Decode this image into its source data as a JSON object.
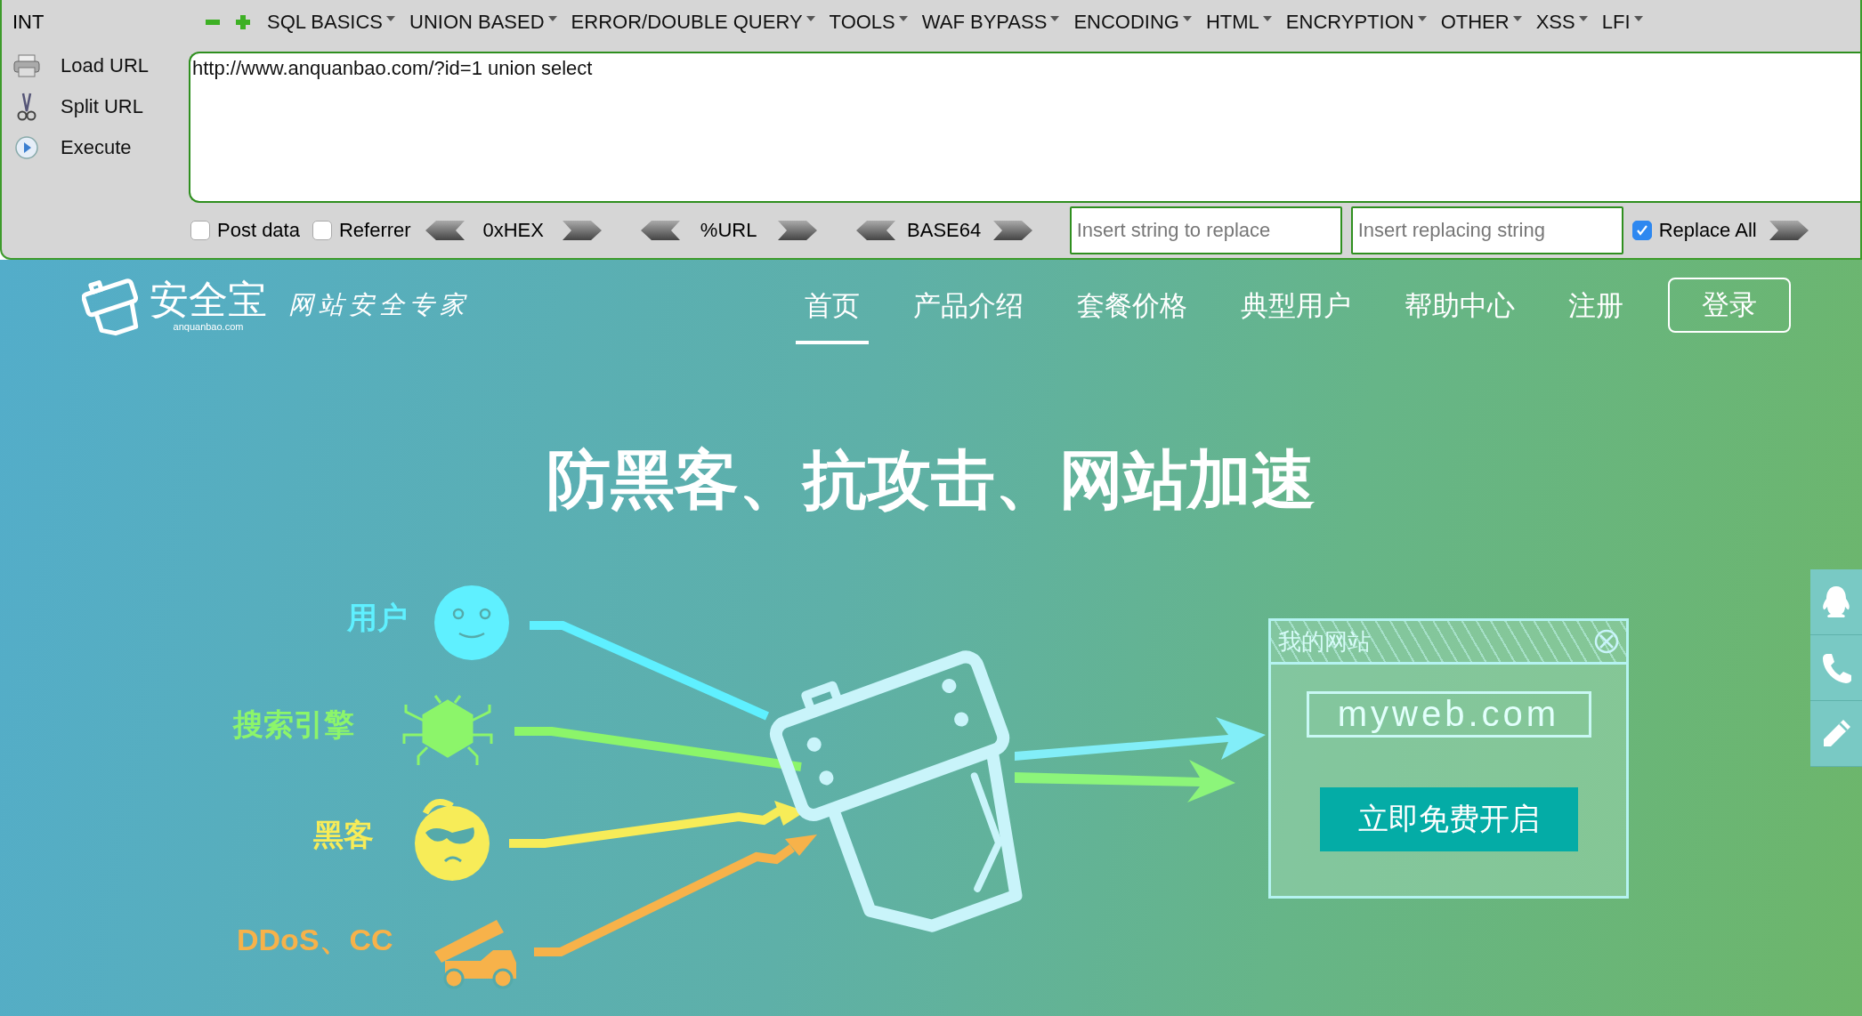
{
  "hackbar": {
    "int_label": "INT",
    "menus": [
      {
        "label": "SQL BASICS"
      },
      {
        "label": "UNION BASED"
      },
      {
        "label": "ERROR/DOUBLE QUERY"
      },
      {
        "label": "TOOLS"
      },
      {
        "label": "WAF BYPASS"
      },
      {
        "label": "ENCODING"
      },
      {
        "label": "HTML"
      },
      {
        "label": "ENCRYPTION"
      },
      {
        "label": "OTHER"
      },
      {
        "label": "XSS"
      },
      {
        "label": "LFI"
      }
    ],
    "side_buttons": [
      {
        "label": "Load URL",
        "kind": "load"
      },
      {
        "label": "Split URL",
        "kind": "split"
      },
      {
        "label": "Execute",
        "kind": "execute"
      }
    ],
    "url": "http://www.anquanbao.com/?id=1 union select",
    "options": [
      {
        "label": "Post data",
        "checked": false
      },
      {
        "label": "Referrer",
        "checked": false
      }
    ],
    "encoders": [
      {
        "label": "0xHEX"
      },
      {
        "label": "%URL"
      },
      {
        "label": "BASE64"
      }
    ],
    "replace_from": {
      "placeholder": "Insert string to replace"
    },
    "replace_to": {
      "placeholder": "Insert replacing string"
    },
    "replace_all": {
      "label": "Replace All",
      "checked": true
    }
  },
  "site": {
    "logo": {
      "name": "安全宝",
      "domain": "anquanbao.com",
      "slogan": "网站安全专家"
    },
    "nav": [
      {
        "label": "首页",
        "selected": true
      },
      {
        "label": "产品介绍",
        "selected": false
      },
      {
        "label": "套餐价格",
        "selected": false
      },
      {
        "label": "典型用户",
        "selected": false
      },
      {
        "label": "帮助中心",
        "selected": false
      },
      {
        "label": "注册",
        "selected": false
      }
    ],
    "login": "登录",
    "headline": "防黑客、抗攻击、网站加速",
    "sources": [
      {
        "label": "用户",
        "kind": "user",
        "color": "#5ff0ff"
      },
      {
        "label": "搜索引擎",
        "kind": "spider",
        "color": "#8cf56a"
      },
      {
        "label": "黑客",
        "kind": "hacker",
        "color": "#f7ec58"
      },
      {
        "label": "DDoS、CC",
        "kind": "ddos",
        "color": "#f7b24a"
      }
    ],
    "site_window": {
      "title": "我的网站",
      "address": "myweb.com",
      "button": "立即免费开启"
    }
  }
}
